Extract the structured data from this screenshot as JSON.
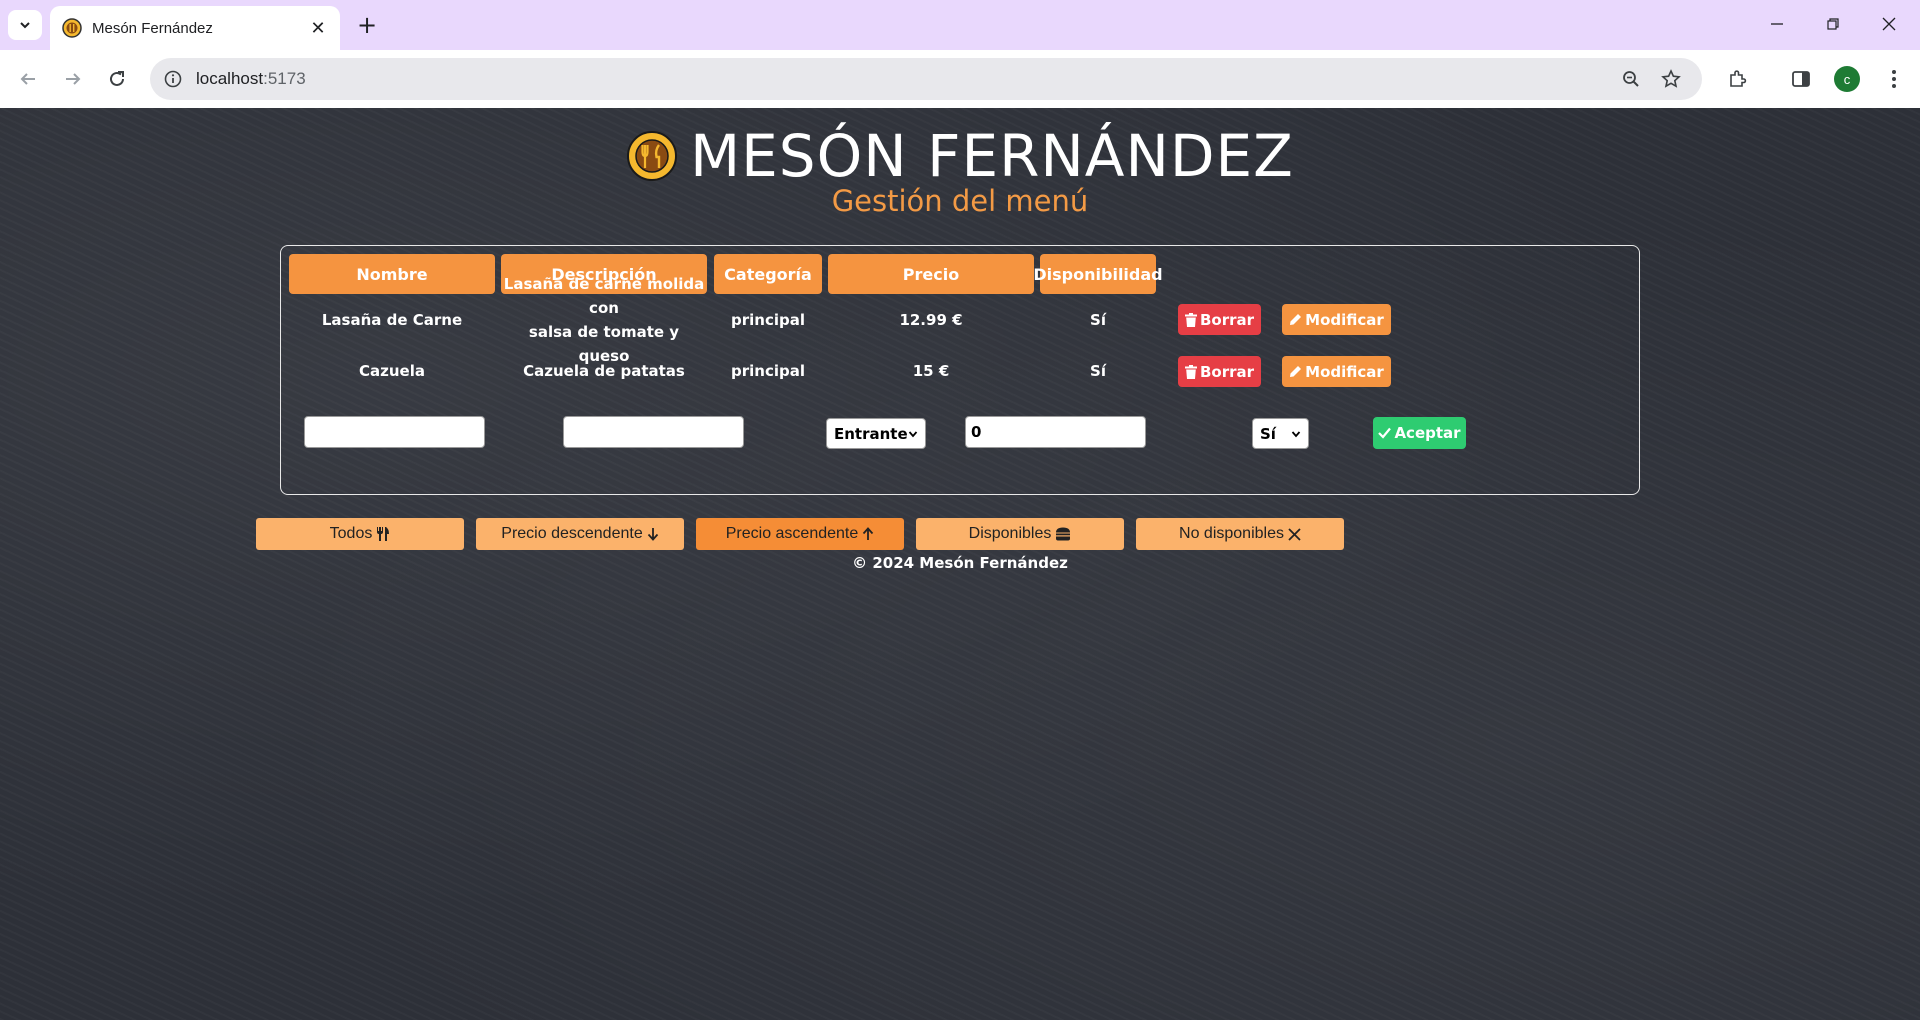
{
  "browser": {
    "tab_title": "Mesón Fernández",
    "url_host": "localhost",
    "url_port": ":5173",
    "avatar_letter": "c"
  },
  "header": {
    "title": "MESÓN FERNÁNDEZ",
    "subtitle": "Gestión del menú"
  },
  "table": {
    "columns": [
      "Nombre",
      "Descripción",
      "Categoría",
      "Precio",
      "Disponibilidad"
    ],
    "rows": [
      {
        "nombre": "Lasaña de Carne",
        "descripcion_line1": "Lasaña de carne molida con",
        "descripcion_line2": "salsa de tomate y queso",
        "categoria": "principal",
        "precio": "12.99 €",
        "disponibilidad": "Sí"
      },
      {
        "nombre": "Cazuela",
        "descripcion_line1": "Cazuela de patatas",
        "descripcion_line2": "",
        "categoria": "principal",
        "precio": "15 €",
        "disponibilidad": "Sí"
      }
    ],
    "delete_label": "Borrar",
    "modify_label": "Modificar"
  },
  "form": {
    "nombre_value": "",
    "descripcion_value": "",
    "categoria_selected": "Entrante",
    "precio_value": "0",
    "disponibilidad_selected": "Sí",
    "accept_label": "Aceptar"
  },
  "filters": [
    {
      "label": "Todos",
      "icon": "utensils-icon",
      "active": false
    },
    {
      "label": "Precio descendente",
      "icon": "arrow-down-icon",
      "active": false
    },
    {
      "label": "Precio ascendente",
      "icon": "arrow-up-icon",
      "active": true
    },
    {
      "label": "Disponibles",
      "icon": "burger-icon",
      "active": false
    },
    {
      "label": "No disponibles",
      "icon": "x-icon",
      "active": false
    }
  ],
  "footer": "© 2024 Mesón Fernández",
  "colors": {
    "accent": "#f59440",
    "delete": "#e63e45",
    "accept": "#2ecc71",
    "filter": "#fbb26b",
    "subtitle": "#f39a45"
  }
}
